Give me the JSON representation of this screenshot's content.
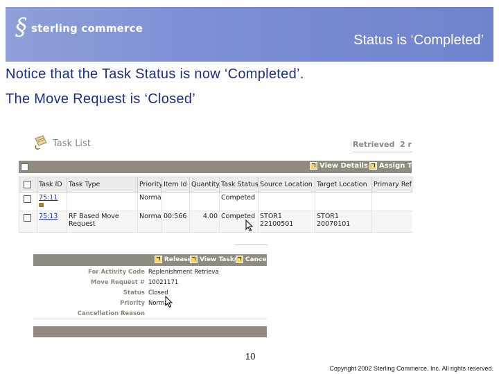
{
  "banner": {
    "logo_symbol": "§",
    "logo_text": "sterling commerce",
    "title": "Status is ‘Completed’"
  },
  "notice": {
    "line1": "Notice that the Task Status is now ‘Completed’.",
    "line2": "The Move Request is ‘Closed’"
  },
  "task_list": {
    "title": "Task List",
    "retrieved_label": "Retrieved",
    "retrieved_count": "2 r",
    "toolbar": {
      "view_details": "View Details",
      "assign_to": "Assign To"
    },
    "columns": [
      "Task ID",
      "Task Type",
      "Priority",
      "Item Id",
      "Quantity",
      "Task Status",
      "Source Location",
      "Target Location",
      "Primary Ref"
    ],
    "rows": [
      {
        "task_id": "75:11",
        "task_type": "",
        "priority": "Normal",
        "item_id": "",
        "quantity": "",
        "task_status": "Competed",
        "source_location": "",
        "target_location": "",
        "primary_ref": ""
      },
      {
        "task_id": "75:13",
        "task_type": "RF Based Move Request",
        "priority": "Normal",
        "item_id": "00:566",
        "quantity": "4.00",
        "task_status": "Competed",
        "source_location": "STOR1 22100501",
        "target_location": "STOR1 20070101",
        "primary_ref": ""
      }
    ]
  },
  "move_request": {
    "toolbar": {
      "release": "Release",
      "view_tasks": "View Tasks",
      "cancel": "Cancel"
    },
    "fields": [
      {
        "label": "For Activity Code",
        "value": "Replenishment Retrieva"
      },
      {
        "label": "Move Request #",
        "value": "10021171"
      },
      {
        "label": "Status",
        "value": "Closed"
      },
      {
        "label": "Priority",
        "value": "Normal"
      },
      {
        "label": "Cancellation Reason",
        "value": ""
      }
    ]
  },
  "footer": {
    "page_number": "10",
    "copyright": "Copyright 2002 Sterling Commerce, Inc. All rights reserved."
  },
  "colors": {
    "banner": "#7c8fd4",
    "notice_text": "#1a2e8a",
    "toolbar": "#8f8b80",
    "link": "#2233cc"
  },
  "icons": [
    "logo-icon",
    "task-list-icon",
    "view-details-icon",
    "assign-to-icon",
    "release-icon",
    "view-tasks-icon",
    "cancel-icon",
    "mouse-cursor-icon",
    "lock-icon"
  ]
}
